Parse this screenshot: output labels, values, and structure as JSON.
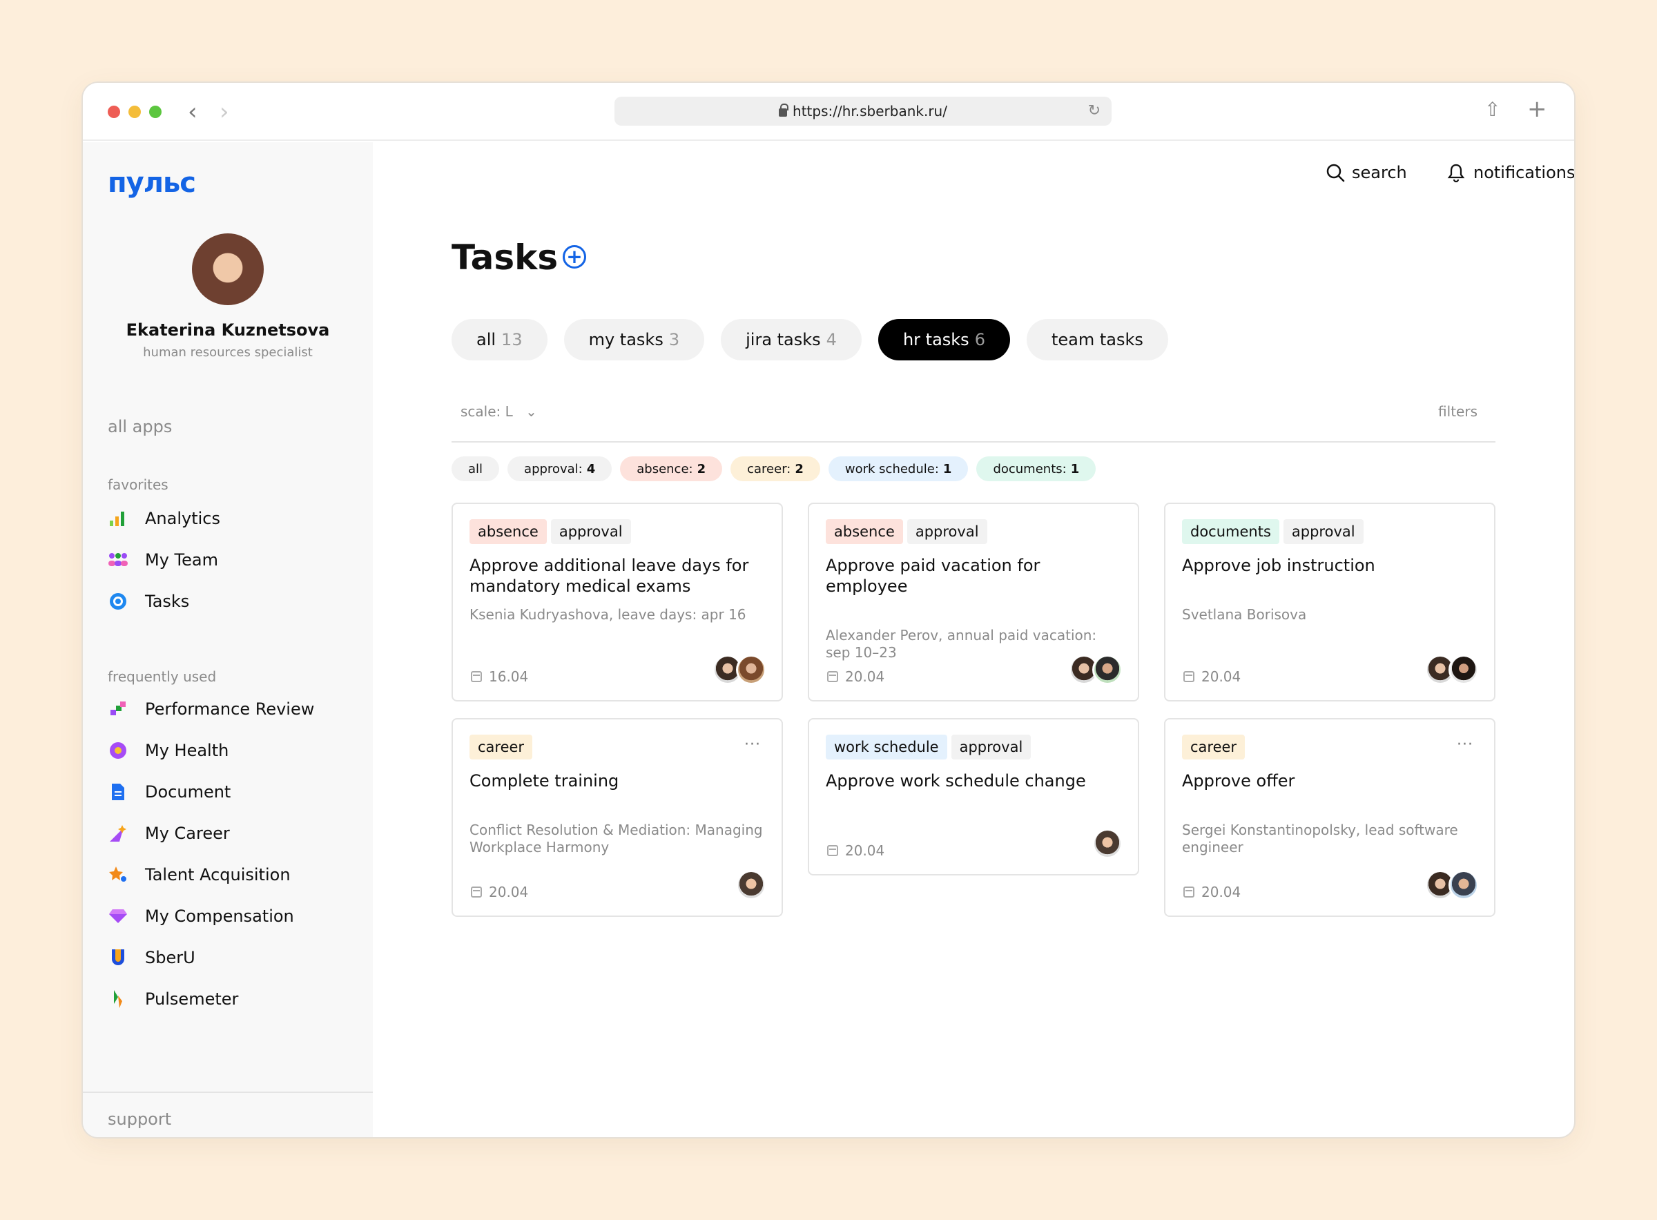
{
  "browser": {
    "url": "https://hr.sberbank.ru/"
  },
  "sidebar": {
    "logo": "пульс",
    "user": {
      "name": "Ekaterina Kuznetsova",
      "role": "human resources specialist"
    },
    "all_apps": "all apps",
    "favorites_title": "favorites",
    "favorites": [
      {
        "label": "Analytics",
        "icon": "analytics-icon"
      },
      {
        "label": "My Team",
        "icon": "team-icon"
      },
      {
        "label": "Tasks",
        "icon": "tasks-icon"
      }
    ],
    "frequent_title": "frequently used",
    "frequent": [
      {
        "label": "Performance Review",
        "icon": "performance-icon"
      },
      {
        "label": "My Health",
        "icon": "health-icon"
      },
      {
        "label": "Document",
        "icon": "document-icon"
      },
      {
        "label": "My Career",
        "icon": "career-icon"
      },
      {
        "label": "Talent Acquisition",
        "icon": "talent-icon"
      },
      {
        "label": "My Compensation",
        "icon": "compensation-icon"
      },
      {
        "label": "SberU",
        "icon": "sberu-icon"
      },
      {
        "label": "Pulsemeter",
        "icon": "pulsemeter-icon"
      }
    ],
    "support": "support"
  },
  "topbar": {
    "search": "search",
    "notifications": "notifications"
  },
  "page": {
    "title": "Tasks",
    "add_symbol": "+"
  },
  "tabs": [
    {
      "label": "all",
      "count": "13",
      "active": false
    },
    {
      "label": "my tasks",
      "count": "3",
      "active": false
    },
    {
      "label": "jira tasks",
      "count": "4",
      "active": false
    },
    {
      "label": "hr tasks",
      "count": "6",
      "active": true
    },
    {
      "label": "team tasks",
      "count": "",
      "active": false
    }
  ],
  "toolbar": {
    "scale": "scale: L",
    "filters": "filters"
  },
  "chips": [
    {
      "label": "all",
      "count": "",
      "color": "#f2f2f2"
    },
    {
      "label": "approval:",
      "count": "4",
      "color": "#f2f2f2"
    },
    {
      "label": "absence:",
      "count": "2",
      "color": "#fde2dc"
    },
    {
      "label": "career:",
      "count": "2",
      "color": "#fdf0d8"
    },
    {
      "label": "work schedule:",
      "count": "1",
      "color": "#e4f1fd"
    },
    {
      "label": "documents:",
      "count": "1",
      "color": "#dff7ee"
    }
  ],
  "cards": [
    {
      "tags": [
        "absence",
        "approval"
      ],
      "title": "Approve additional leave days for mandatory medical exams",
      "subtitle": "Ksenia Kudryashova, leave days:  apr 16",
      "date": "16.04"
    },
    {
      "tags": [
        "absence",
        "approval"
      ],
      "title": "Approve paid vacation for employee",
      "subtitle": "Alexander Perov, annual paid vacation: sep 10–23",
      "date": "20.04"
    },
    {
      "tags": [
        "documents",
        "approval"
      ],
      "title": "Approve job instruction",
      "subtitle": "Svetlana Borisova",
      "date": "20.04"
    },
    {
      "tags": [
        "career"
      ],
      "title": "Complete training",
      "subtitle": "Conflict Resolution & Mediation: Managing Workplace Harmony",
      "date": "20.04",
      "more": "···"
    },
    {
      "tags": [
        "work schedule",
        "approval"
      ],
      "title": "Approve work schedule change",
      "subtitle": "",
      "date": "20.04"
    },
    {
      "tags": [
        "career"
      ],
      "title": "Approve offer",
      "subtitle": "Sergei Konstantinopolsky, lead software engineer",
      "date": "20.04",
      "more": "···"
    }
  ]
}
